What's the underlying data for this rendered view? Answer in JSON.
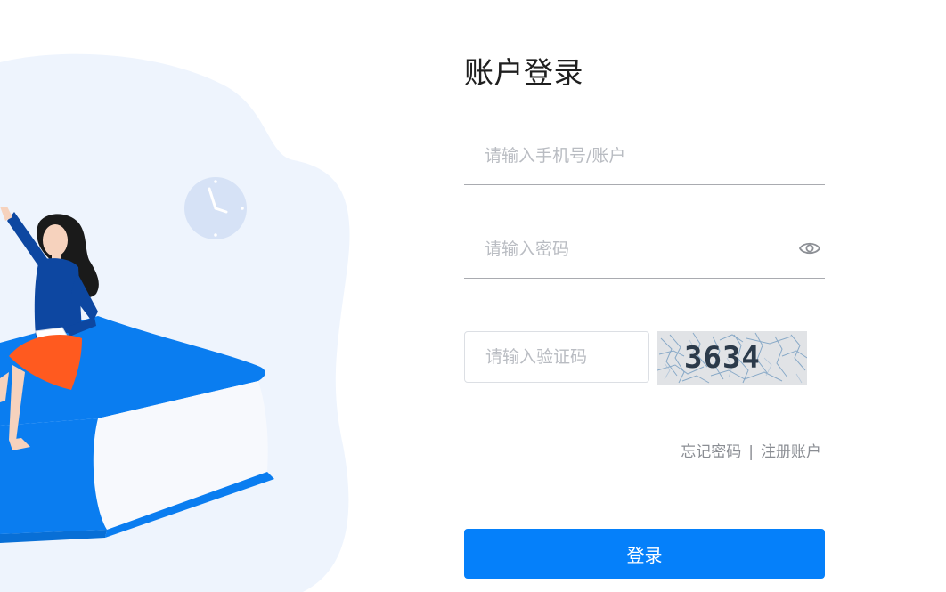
{
  "login": {
    "title": "账户登录",
    "account_placeholder": "请输入手机号/账户",
    "password_placeholder": "请输入密码",
    "captcha_placeholder": "请输入验证码",
    "captcha_code": "3634",
    "forgot_password": "忘记密码",
    "separator": "|",
    "register": "注册账户",
    "submit_label": "登录"
  },
  "icons": {
    "password_toggle": "eye-icon",
    "clock": "clock-icon"
  },
  "colors": {
    "primary": "#0580fa",
    "title": "#1f1f1f",
    "placeholder": "#b9bcc2",
    "link": "#8a8d93",
    "underline": "#a9abb0",
    "blob": "#eef4fd",
    "book": "#0a7df0"
  }
}
